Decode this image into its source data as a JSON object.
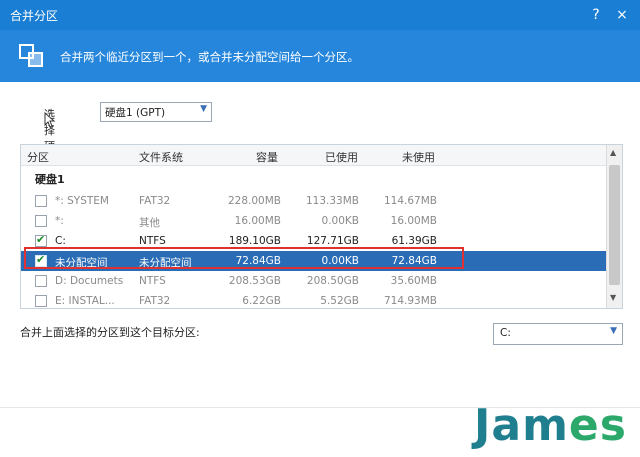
{
  "window": {
    "title": "合并分区",
    "help_glyph": "?",
    "close_glyph": "×"
  },
  "banner": {
    "text": "合并两个临近分区到一个，或合并未分配空间给一个分区。",
    "icon": "merge-partitions-icon"
  },
  "disk": {
    "label": "选择硬盘:",
    "selected": "硬盘1 (GPT)"
  },
  "table": {
    "columns": [
      "分区",
      "文件系统",
      "容量",
      "已使用",
      "未使用"
    ],
    "group": "硬盘1",
    "rows": [
      {
        "checked": false,
        "partition": "*: SYSTEM",
        "fs": "FAT32",
        "capacity": "228.00MB",
        "used": "113.33MB",
        "free": "114.67MB",
        "dim": true,
        "selected": false
      },
      {
        "checked": false,
        "partition": "*:",
        "fs": "其他",
        "capacity": "16.00MB",
        "used": "0.00KB",
        "free": "16.00MB",
        "dim": true,
        "selected": false
      },
      {
        "checked": true,
        "partition": "C:",
        "fs": "NTFS",
        "capacity": "189.10GB",
        "used": "127.71GB",
        "free": "61.39GB",
        "dim": false,
        "selected": false
      },
      {
        "checked": true,
        "partition": "未分配空间",
        "fs": "未分配空间",
        "capacity": "72.84GB",
        "used": "0.00KB",
        "free": "72.84GB",
        "dim": false,
        "selected": true
      },
      {
        "checked": false,
        "partition": "D: Documets",
        "fs": "NTFS",
        "capacity": "208.53GB",
        "used": "208.50GB",
        "free": "35.60MB",
        "dim": true,
        "selected": false
      },
      {
        "checked": false,
        "partition": "E: INSTAL...",
        "fs": "FAT32",
        "capacity": "6.22GB",
        "used": "5.52GB",
        "free": "714.93MB",
        "dim": true,
        "selected": false
      }
    ]
  },
  "target": {
    "label": "合并上面选择的分区到这个目标分区:",
    "selected": "C:"
  },
  "watermark": {
    "text_a": "Jam",
    "text_b": "es"
  },
  "colors": {
    "titlebar": "#1a7fd4",
    "banner": "#2586dc",
    "selected_row": "#2a6cb5",
    "highlight_box": "#e03030",
    "check": "#1a8c2a",
    "watermark_a": "#1f7f8f",
    "watermark_b": "#2ba86a"
  }
}
